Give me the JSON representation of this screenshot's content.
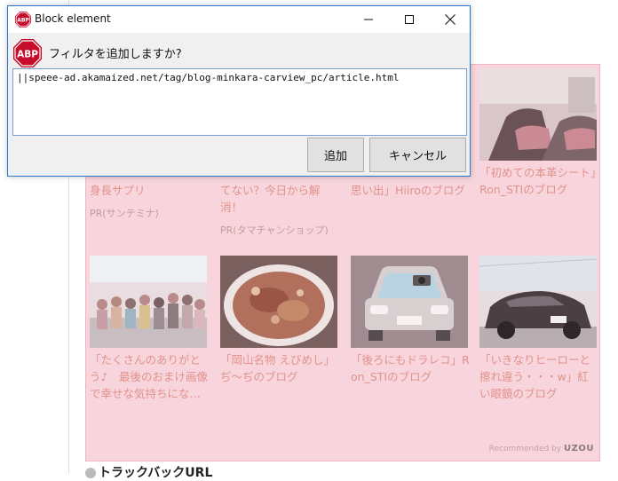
{
  "dialog": {
    "title": "Block element",
    "question": "フィルタを追加しますか?",
    "filter_value": "||speee-ad.akamaized.net/tag/blog-minkara-carview_pc/article.html",
    "add_label": "追加",
    "cancel_label": "キャンセル",
    "logo_text": "ABP"
  },
  "ads": {
    "row1": [
      {
        "title": "身長サプリ",
        "pr": "PR(サンテミナ)"
      },
      {
        "title": "てない？今日から解消！",
        "pr": "PR(タマチャンショップ)"
      },
      {
        "title": "思い出」Hiiroのブログ",
        "pr": ""
      },
      {
        "title": "「初めての本革シート」Ron_STIのブログ",
        "pr": ""
      }
    ],
    "row2": [
      {
        "title": "「たくさんのありがとう♪　最後のおまけ画像で幸せな気持ちにな…"
      },
      {
        "title": "「岡山名物 えびめし」ぢ〜ぢのブログ"
      },
      {
        "title": "「後ろにもドラレコ」Ron_STIのブログ"
      },
      {
        "title": "「いきなりヒーローと擦れ違う・・・w」紅い眼鏡のブログ"
      }
    ],
    "recommended_prefix": "Recommended by",
    "recommended_brand": "UZOU"
  },
  "trackback": "トラックバックURL"
}
